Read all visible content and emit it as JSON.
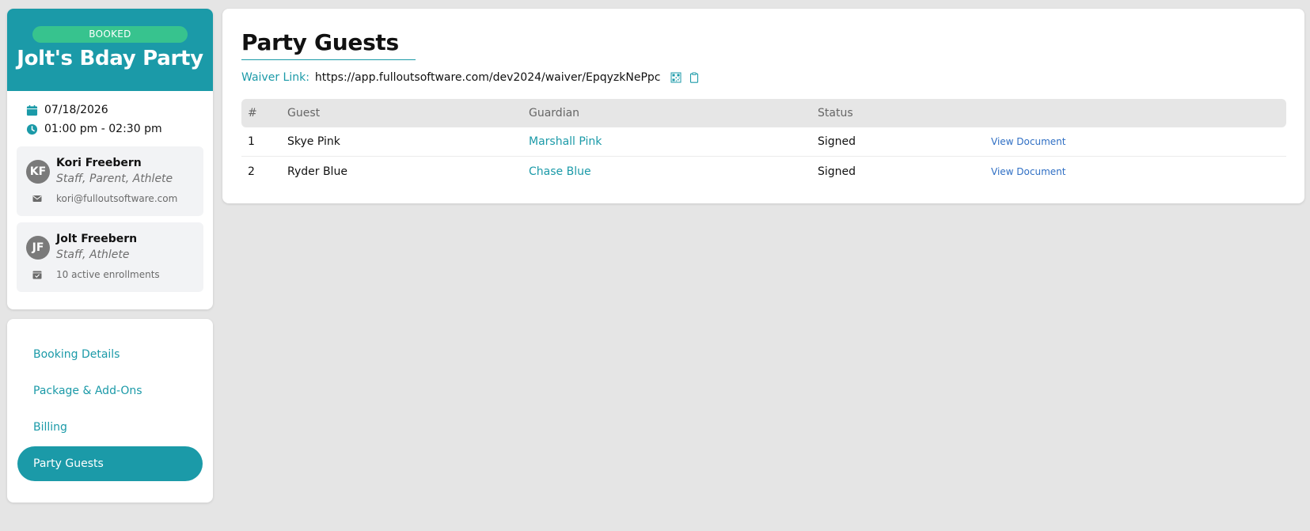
{
  "booking": {
    "status": "BOOKED",
    "title": "Jolt's Bday Party",
    "date": "07/18/2026",
    "time": "01:00 pm - 02:30 pm"
  },
  "people": [
    {
      "initials": "KF",
      "name": "Kori Freebern",
      "roles": "Staff, Parent, Athlete",
      "meta": "kori@fulloutsoftware.com",
      "meta_icon": "envelope-icon"
    },
    {
      "initials": "JF",
      "name": "Jolt Freebern",
      "roles": "Staff, Athlete",
      "meta": "10 active enrollments",
      "meta_icon": "calendar-check-icon"
    }
  ],
  "nav": {
    "items": [
      {
        "label": "Booking Details"
      },
      {
        "label": "Package & Add-Ons"
      },
      {
        "label": "Billing"
      },
      {
        "label": "Party Guests"
      }
    ],
    "active": "Party Guests"
  },
  "main": {
    "title": "Party Guests",
    "waiver_label": "Waiver Link:",
    "waiver_url": "https://app.fulloutsoftware.com/dev2024/waiver/EpqyzkNePpc",
    "table": {
      "headers": [
        "#",
        "Guest",
        "Guardian",
        "Status",
        ""
      ],
      "rows": [
        {
          "num": "1",
          "guest": "Skye Pink",
          "guardian": "Marshall Pink",
          "status": "Signed",
          "action": "View Document"
        },
        {
          "num": "2",
          "guest": "Ryder Blue",
          "guardian": "Chase Blue",
          "status": "Signed",
          "action": "View Document"
        }
      ]
    }
  },
  "colors": {
    "brand": "#1b9aa8",
    "status_booked": "#37c38e",
    "background": "#e5e5e5",
    "doc_link": "#2f6fc4"
  }
}
